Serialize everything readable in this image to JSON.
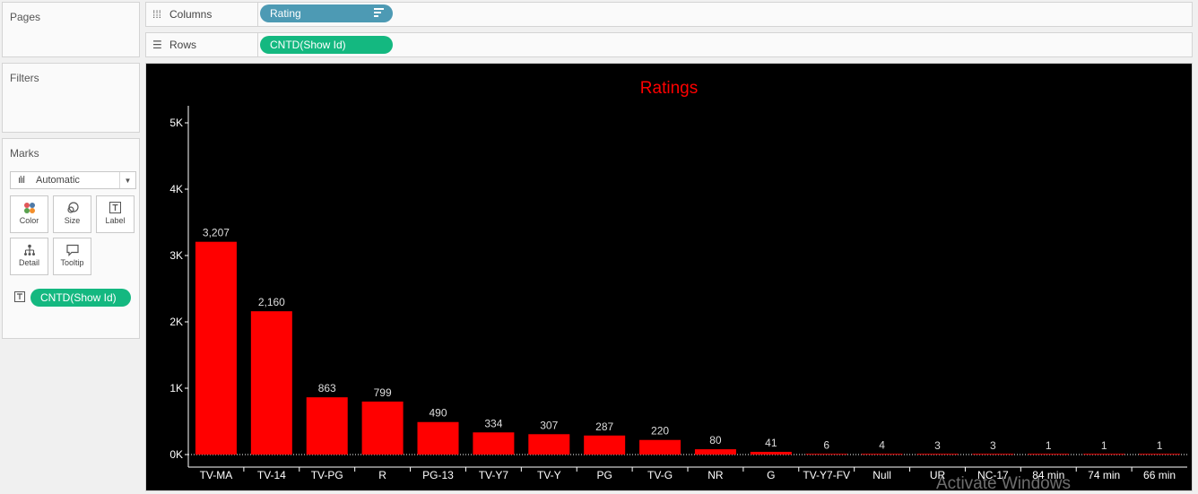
{
  "cards": {
    "pages": {
      "title": "Pages"
    },
    "filters": {
      "title": "Filters"
    },
    "marks": {
      "title": "Marks",
      "mark_type": "Automatic",
      "buttons": {
        "color": "Color",
        "size": "Size",
        "label": "Label",
        "detail": "Detail",
        "tooltip": "Tooltip"
      },
      "label_field": "CNTD(Show Id)"
    }
  },
  "shelves": {
    "columns": {
      "label": "Columns",
      "pill": "Rating"
    },
    "rows": {
      "label": "Rows",
      "pill": "CNTD(Show Id)"
    }
  },
  "watermark": "Activate Windows",
  "colors": {
    "bar": "#ff0000",
    "title": "#ff0000",
    "background": "#000000",
    "axis": "#ffffff",
    "pill_dimension": "#4d9ab4",
    "pill_measure": "#14b880"
  },
  "chart_data": {
    "type": "bar",
    "title": "Ratings",
    "xlabel": "",
    "ylabel": "",
    "ylim": [
      0,
      5000
    ],
    "yticks": [
      0,
      1000,
      2000,
      3000,
      4000,
      5000
    ],
    "ytick_labels": [
      "0K",
      "1K",
      "2K",
      "3K",
      "4K",
      "5K"
    ],
    "grid": false,
    "categories": [
      "TV-MA",
      "TV-14",
      "TV-PG",
      "R",
      "PG-13",
      "TV-Y7",
      "TV-Y",
      "PG",
      "TV-G",
      "NR",
      "G",
      "TV-Y7-FV",
      "Null",
      "UR",
      "NC-17",
      "84 min",
      "74 min",
      "66 min"
    ],
    "values": [
      3207,
      2160,
      863,
      799,
      490,
      334,
      307,
      287,
      220,
      80,
      41,
      6,
      4,
      3,
      3,
      1,
      1,
      1
    ],
    "value_labels": [
      "3,207",
      "2,160",
      "863",
      "799",
      "490",
      "334",
      "307",
      "287",
      "220",
      "80",
      "41",
      "6",
      "4",
      "3",
      "3",
      "1",
      "1",
      "1"
    ]
  }
}
